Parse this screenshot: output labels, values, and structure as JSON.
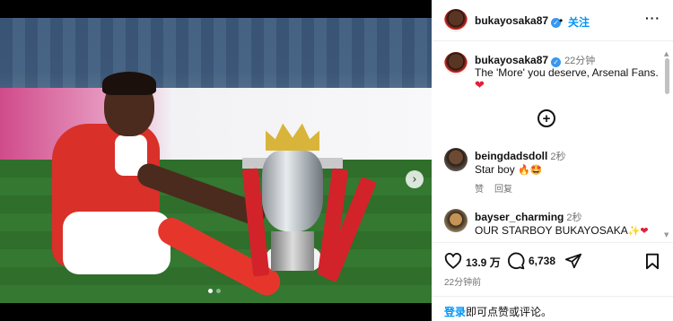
{
  "media": {
    "next_icon": "chevron-right-icon",
    "next_glyph": "›",
    "carousel_dots": 2,
    "active_dot": 0
  },
  "header": {
    "username": "bukayosaka87",
    "verified_glyph": "✓",
    "separator": "•",
    "follow_label": "关注",
    "more_glyph": "···"
  },
  "caption": {
    "username": "bukayosaka87",
    "time": "22分钟",
    "text": "The 'More' you deserve, Arsenal Fans.",
    "emoji": "❤"
  },
  "add_comment_glyph": "+",
  "comments": [
    {
      "username": "beingdadsdoll",
      "time": "2秒",
      "text": "Star boy ",
      "emoji": "🔥🤩",
      "like_label": "赞",
      "reply_label": "回复"
    },
    {
      "username": "bayser_charming",
      "time": "2秒",
      "text": "OUR STARBOY BUKAYOSAKA",
      "emoji": "✨❤"
    }
  ],
  "scroll": {
    "up_glyph": "▲",
    "down_glyph": "▼"
  },
  "stats": {
    "likes": "13.9 万",
    "comments": "6,738"
  },
  "post_time": "22分钟前",
  "footer": {
    "login_link": "登录",
    "login_text": "即可点赞或评论。"
  },
  "colors": {
    "accent": "#0095f6",
    "heart": "#e0213b",
    "verified": "#3897f0"
  }
}
